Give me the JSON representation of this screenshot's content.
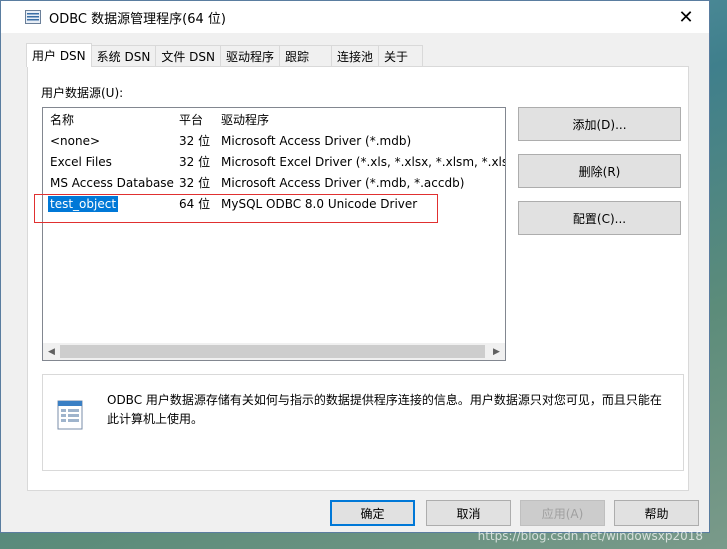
{
  "window": {
    "title": "ODBC 数据源管理程序(64 位)",
    "close": "✕"
  },
  "tabs": [
    "用户 DSN",
    "系统 DSN",
    "文件 DSN",
    "驱动程序",
    "跟踪",
    "连接池",
    "关于"
  ],
  "list": {
    "label": "用户数据源(U):",
    "headers": {
      "name": "名称",
      "platform": "平台",
      "driver": "驱动程序"
    },
    "rows": [
      {
        "name": "<none>",
        "platform": "32 位",
        "driver": "Microsoft Access Driver (*.mdb)"
      },
      {
        "name": "Excel Files",
        "platform": "32 位",
        "driver": "Microsoft Excel Driver (*.xls, *.xlsx, *.xlsm, *.xlsb)"
      },
      {
        "name": "MS Access Database",
        "platform": "32 位",
        "driver": "Microsoft Access Driver (*.mdb, *.accdb)"
      },
      {
        "name": "test_object",
        "platform": "64 位",
        "driver": "MySQL ODBC 8.0 Unicode Driver"
      }
    ],
    "selected_index": 3
  },
  "side_buttons": {
    "add": "添加(D)...",
    "remove": "删除(R)",
    "configure": "配置(C)..."
  },
  "info": {
    "text": "ODBC 用户数据源存储有关如何与指示的数据提供程序连接的信息。用户数据源只对您可见，而且只能在此计算机上使用。"
  },
  "bottom_buttons": {
    "ok": "确定",
    "cancel": "取消",
    "apply": "应用(A)",
    "help": "帮助"
  },
  "watermark": "https://blog.csdn.net/windowsxp2018",
  "colors": {
    "selection": "#0078d7",
    "highlight_box": "#e03030"
  }
}
